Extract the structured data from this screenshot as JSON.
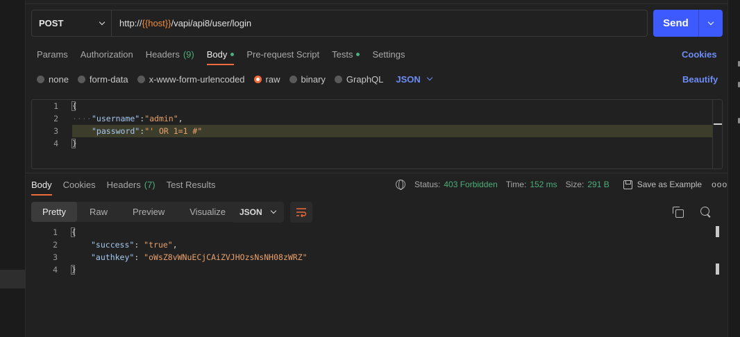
{
  "request": {
    "method": "POST",
    "url_prefix": "http://",
    "url_var": "{{host}}",
    "url_path": "/vapi/api8/user/login",
    "send_label": "Send"
  },
  "request_tabs": [
    {
      "label": "Params"
    },
    {
      "label": "Authorization"
    },
    {
      "label": "Headers",
      "count": "(9)"
    },
    {
      "label": "Body",
      "dot": true,
      "active": true
    },
    {
      "label": "Pre-request Script"
    },
    {
      "label": "Tests",
      "dot": true
    },
    {
      "label": "Settings"
    }
  ],
  "cookies_label": "Cookies",
  "beautify_label": "Beautify",
  "body_types": [
    "none",
    "form-data",
    "x-www-form-urlencoded",
    "raw",
    "binary",
    "GraphQL"
  ],
  "body_type_selected": "raw",
  "body_format": "JSON",
  "request_body": {
    "line_numbers": [
      "1",
      "2",
      "3",
      "4"
    ],
    "open": "{",
    "indent_dots": "····",
    "username_key": "\"username\"",
    "username_val": "\"admin\"",
    "password_key": "\"password\"",
    "password_val": "\"' OR 1=1 #\"",
    "close": "}"
  },
  "response_tabs": [
    {
      "label": "Body",
      "active": true
    },
    {
      "label": "Cookies"
    },
    {
      "label": "Headers",
      "count": "(7)"
    },
    {
      "label": "Test Results"
    }
  ],
  "response_meta": {
    "status_label": "Status:",
    "status_value": "403 Forbidden",
    "time_label": "Time:",
    "time_value": "152 ms",
    "size_label": "Size:",
    "size_value": "291 B",
    "save_example": "Save as Example",
    "more": "ooo"
  },
  "view_modes": [
    "Pretty",
    "Raw",
    "Preview",
    "Visualize"
  ],
  "view_mode_active": "Pretty",
  "response_format": "JSON",
  "response_body": {
    "line_numbers": [
      "1",
      "2",
      "3",
      "4"
    ],
    "open": "{",
    "success_key": "\"success\"",
    "success_val": "\"true\"",
    "authkey_key": "\"authkey\"",
    "authkey_val": "\"oWsZ8vWNuECjCAiZVJHOzsNsNH08zWRZ\"",
    "close": "}"
  },
  "colors": {
    "accent": "#f26b3a",
    "send": "#3d5afe",
    "link": "#6d8cf5",
    "success": "#4cae7a"
  }
}
